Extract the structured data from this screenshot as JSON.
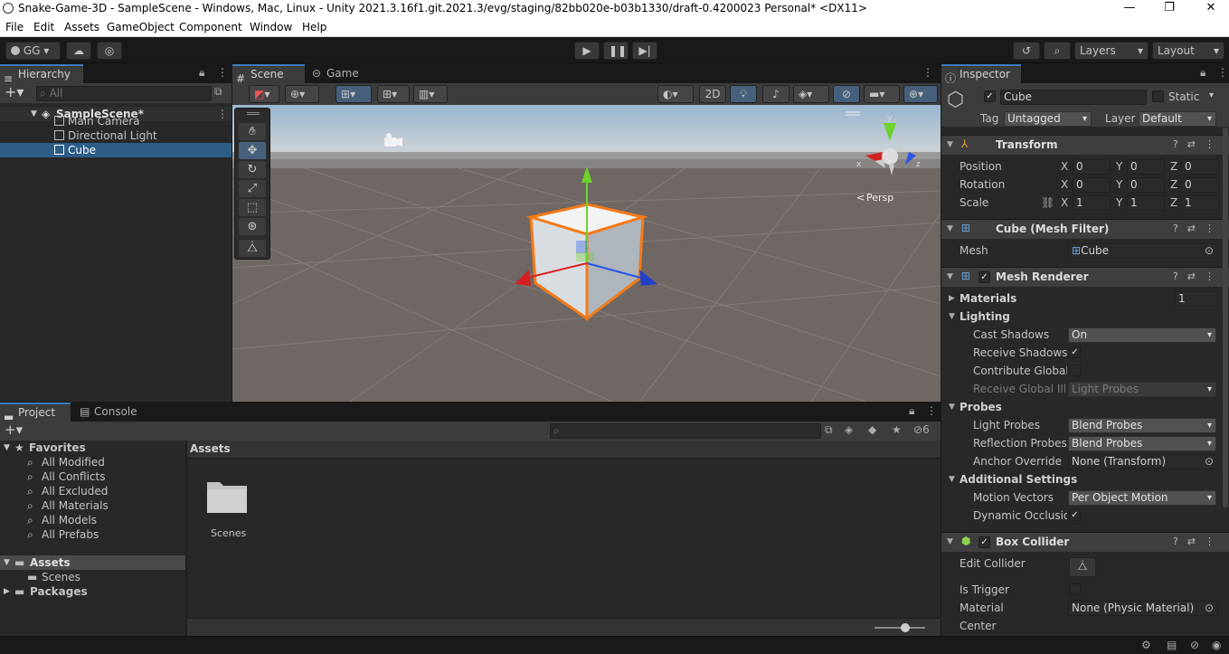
{
  "window": {
    "title": "Snake-Game-3D - SampleScene - Windows, Mac, Linux - Unity 2021.3.16f1.git.2021.3/evg/staging/82bb020e-b03b1330/draft-0.4200023 Personal* <DX11>"
  },
  "menu": [
    "File",
    "Edit",
    "Assets",
    "GameObject",
    "Component",
    "Window",
    "Help"
  ],
  "toolbar": {
    "account": "GG",
    "layers": "Layers",
    "layout": "Layout"
  },
  "hierarchy": {
    "tab": "Hierarchy",
    "search_placeholder": "All",
    "scene": "SampleScene*",
    "items": [
      "Main Camera",
      "Directional Light",
      "Cube"
    ]
  },
  "scene_view": {
    "tabs": [
      "Scene",
      "Game"
    ],
    "mode_2d": "2D",
    "persp": "Persp",
    "gizmo_axes": {
      "x": "x",
      "y": "y",
      "z": "z"
    }
  },
  "project": {
    "tabs": [
      "Project",
      "Console"
    ],
    "hidden_count": "6",
    "favorites_label": "Favorites",
    "favorites": [
      "All Modified",
      "All Conflicts",
      "All Excluded",
      "All Materials",
      "All Models",
      "All Prefabs"
    ],
    "assets_label": "Assets",
    "asset_children": [
      "Scenes"
    ],
    "packages_label": "Packages",
    "breadcrumb": "Assets",
    "grid_items": [
      "Scenes"
    ]
  },
  "inspector": {
    "tab": "Inspector",
    "object_name": "Cube",
    "static_label": "Static",
    "tag_label": "Tag",
    "tag_value": "Untagged",
    "layer_label": "Layer",
    "layer_value": "Default",
    "transform": {
      "title": "Transform",
      "rows": [
        {
          "label": "Position",
          "x": "0",
          "y": "0",
          "z": "0"
        },
        {
          "label": "Rotation",
          "x": "0",
          "y": "0",
          "z": "0"
        },
        {
          "label": "Scale",
          "x": "1",
          "y": "1",
          "z": "1"
        }
      ],
      "axis": {
        "x": "X",
        "y": "Y",
        "z": "Z"
      }
    },
    "mesh_filter": {
      "title": "Cube (Mesh Filter)",
      "mesh_label": "Mesh",
      "mesh_value": "Cube"
    },
    "mesh_renderer": {
      "title": "Mesh Renderer",
      "materials_label": "Materials",
      "materials_count": "1",
      "lighting_label": "Lighting",
      "cast_shadows_label": "Cast Shadows",
      "cast_shadows_value": "On",
      "receive_shadows_label": "Receive Shadows",
      "contribute_gi_label": "Contribute Global I",
      "receive_gi_label": "Receive Global Illu",
      "receive_gi_value": "Light Probes",
      "probes_label": "Probes",
      "light_probes_label": "Light Probes",
      "light_probes_value": "Blend Probes",
      "reflection_probes_label": "Reflection Probes",
      "reflection_probes_value": "Blend Probes",
      "anchor_label": "Anchor Override",
      "anchor_value": "None (Transform)",
      "additional_label": "Additional Settings",
      "motion_label": "Motion Vectors",
      "motion_value": "Per Object Motion",
      "occlusion_label": "Dynamic Occlusion"
    },
    "box_collider": {
      "title": "Box Collider",
      "edit_label": "Edit Collider",
      "trigger_label": "Is Trigger",
      "material_label": "Material",
      "material_value": "None (Physic Material)",
      "center_label": "Center"
    }
  }
}
